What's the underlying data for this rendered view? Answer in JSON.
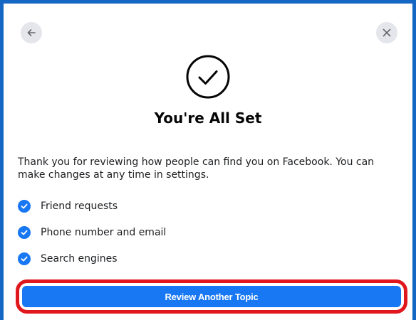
{
  "header": {
    "back_icon": "arrow-left-icon",
    "close_icon": "close-icon"
  },
  "hero": {
    "icon": "check-circle-icon"
  },
  "title": "You're All Set",
  "description": "Thank you for reviewing how people can find you on Facebook. You can make changes at any time in settings.",
  "checklist": {
    "icon": "check-badge-icon",
    "items": [
      {
        "label": "Friend requests"
      },
      {
        "label": "Phone number and email"
      },
      {
        "label": "Search engines"
      }
    ]
  },
  "footer": {
    "primary_label": "Review Another Topic"
  },
  "colors": {
    "primary": "#1877f2",
    "frame": "#1467c2",
    "highlight": "#e0181e",
    "icon_bg": "#e4e6eb"
  }
}
